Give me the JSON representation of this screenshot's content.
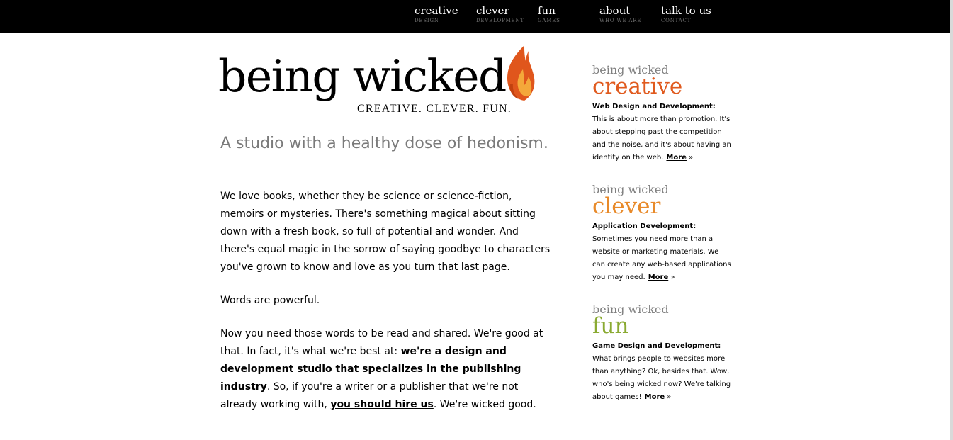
{
  "nav": [
    {
      "label": "creative",
      "sub": "DESIGN"
    },
    {
      "label": "clever",
      "sub": "DEVELOPMENT"
    },
    {
      "label": "fun",
      "sub": "GAMES"
    },
    {
      "label": "about",
      "sub": "WHO WE ARE"
    },
    {
      "label": "talk to us",
      "sub": "CONTACT"
    }
  ],
  "logo": {
    "wordmark": "being wicked",
    "tagline": "CREATIVE.  CLEVER.  FUN."
  },
  "main": {
    "headline": "A studio with a healthy dose of hedonism.",
    "p1": "We love books, whether they be science or science-fiction, memoirs or mysteries. There's something magical about sitting down with a fresh book, so full of potential and wonder. And there's equal magic in the sorrow of saying goodbye to characters you've grown to know and love as you turn that last page.",
    "p2": "Words are powerful.",
    "p3_a": "Now you need those words to be read and shared. We're good at that. In fact, it's what we're best at: ",
    "p3_bold": "we're a design and development studio that specializes in the publishing industry",
    "p3_b": ". So, if you're a writer or a publisher that we're not already working with, ",
    "p3_link": "you should hire us",
    "p3_c": ". We're wicked good."
  },
  "sidebar": [
    {
      "kicker": "being wicked",
      "title": "creative",
      "color": "#e05a1e",
      "lead": "Web Design and Development:",
      "text": " This is about more than promotion. It's about stepping past the competition and the noise, and it's about having an identity on the web.",
      "more": "More",
      "arrow": "»"
    },
    {
      "kicker": "being wicked",
      "title": "clever",
      "color": "#e88a2a",
      "lead": "Application Development:",
      "text": " Sometimes you need more than a website or marketing materials. We can create any web-based applications you may need.",
      "more": "More",
      "arrow": "»"
    },
    {
      "kicker": "being wicked",
      "title": "fun",
      "color": "#8aaa32",
      "lead": "Game Design and Development:",
      "text": " What brings people to websites more than anything? Ok, besides that. Wow, who's being wicked now? We're talking about games!",
      "more": "More",
      "arrow": "»"
    }
  ],
  "colors": {
    "topbar": "#000000",
    "flame_outer": "#e0561c",
    "flame_inner": "#f4a83a"
  }
}
